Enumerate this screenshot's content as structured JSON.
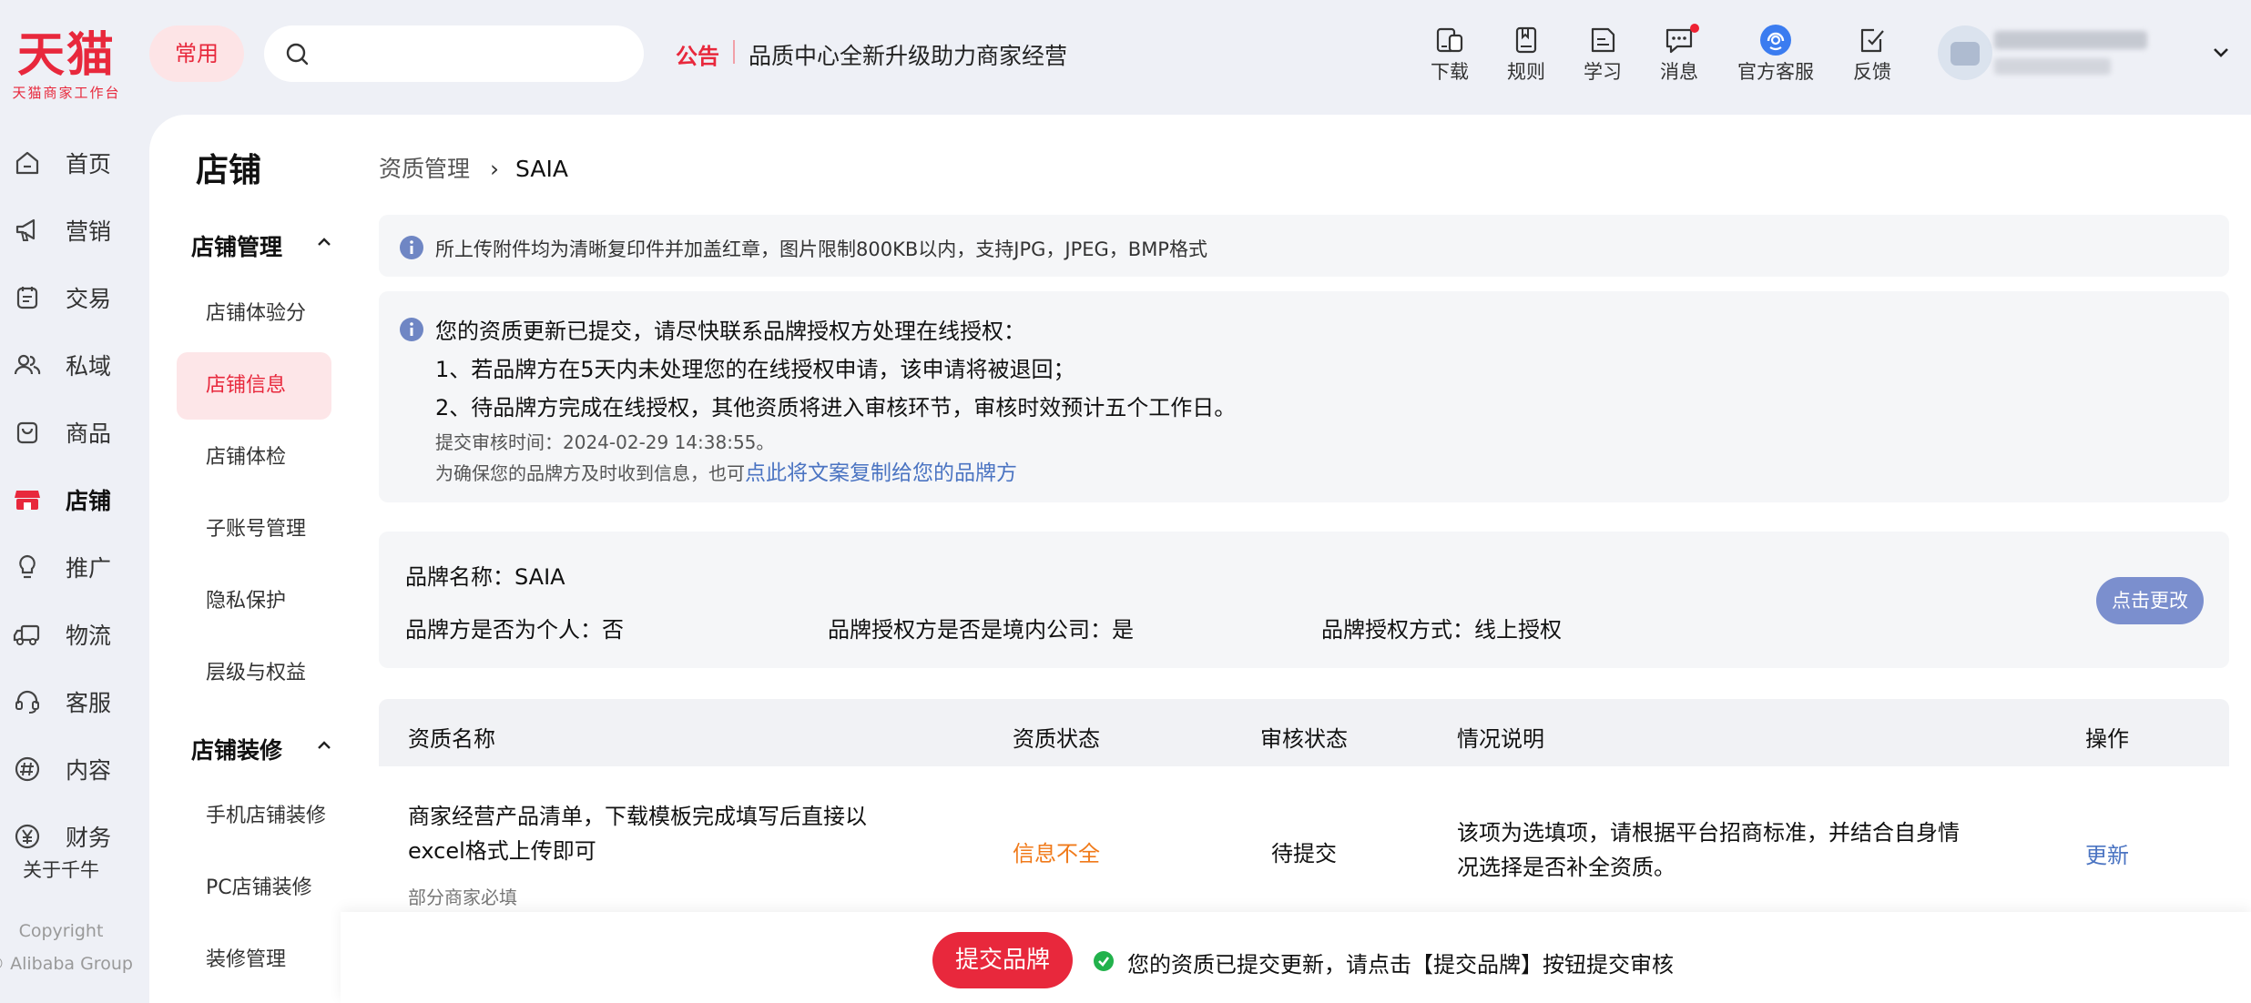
{
  "header": {
    "logo_big": "天猫",
    "logo_small": "天猫商家工作台",
    "common_label": "常用",
    "search_placeholder": "",
    "notice_label": "公告",
    "notice_text": "品质中心全新升级助力商家经营",
    "tools": [
      {
        "label": "下载",
        "icon": "download-icon"
      },
      {
        "label": "规则",
        "icon": "rules-icon"
      },
      {
        "label": "学习",
        "icon": "learn-icon"
      },
      {
        "label": "消息",
        "icon": "message-icon",
        "badge": true
      },
      {
        "label": "官方客服",
        "icon": "support-icon"
      },
      {
        "label": "反馈",
        "icon": "feedback-icon"
      }
    ]
  },
  "nav": {
    "items": [
      {
        "label": "首页",
        "icon": "home-icon"
      },
      {
        "label": "营销",
        "icon": "megaphone-icon"
      },
      {
        "label": "交易",
        "icon": "trade-icon"
      },
      {
        "label": "私域",
        "icon": "people-icon"
      },
      {
        "label": "商品",
        "icon": "bag-icon"
      },
      {
        "label": "店铺",
        "icon": "store-icon",
        "active": true
      },
      {
        "label": "推广",
        "icon": "bulb-icon"
      },
      {
        "label": "物流",
        "icon": "truck-icon"
      },
      {
        "label": "客服",
        "icon": "headset-icon"
      },
      {
        "label": "内容",
        "icon": "hash-icon"
      },
      {
        "label": "财务",
        "icon": "yen-icon"
      }
    ],
    "about": "关于千牛",
    "copyright": "Copyright",
    "company": "© Alibaba Group"
  },
  "sub_nav": {
    "title": "店铺",
    "groups": [
      {
        "label": "店铺管理",
        "items": [
          "店铺体验分",
          "店铺信息",
          "店铺体检",
          "子账号管理",
          "隐私保护",
          "层级与权益"
        ]
      },
      {
        "label": "店铺装修",
        "items": [
          "手机店铺装修",
          "PC店铺装修",
          "装修管理"
        ]
      }
    ],
    "active_item": "店铺信息"
  },
  "breadcrumb": {
    "parent": "资质管理",
    "separator": "›",
    "current": "SAIA"
  },
  "tip1": "所上传附件均为清晰复印件并加盖红章，图片限制800KB以内，支持JPG，JPEG，BMP格式",
  "tip2": {
    "heading": "您的资质更新已提交，请尽快联系品牌授权方处理在线授权：",
    "line1": "1、若品牌方在5天内未处理您的在线授权申请，该申请将被退回；",
    "line2": "2、待品牌方完成在线授权，其他资质将进入审核环节，审核时效预计五个工作日。",
    "submit_time": "提交审核时间：2024-02-29 14:38:55。",
    "hint_prefix": "为确保您的品牌方及时收到信息，也可",
    "hint_link": "点此将文案复制给您的品牌方"
  },
  "brand": {
    "name": "品牌名称：SAIA",
    "is_individual": "品牌方是否为个人：否",
    "is_domestic": "品牌授权方是否是境内公司：是",
    "auth_method": "品牌授权方式：线上授权",
    "change_button": "点击更改"
  },
  "table": {
    "headers": [
      "资质名称",
      "资质状态",
      "审核状态",
      "情况说明",
      "操作"
    ],
    "rows": [
      {
        "name": "商家经营产品清单，下载模板完成填写后直接以excel格式上传即可",
        "note": "部分商家必填",
        "status": "信息不全",
        "review": "待提交",
        "desc": "该项为选填项，请根据平台招商标准，并结合自身情况选择是否补全资质。",
        "action": "更新"
      }
    ]
  },
  "footer": {
    "submit_button": "提交品牌",
    "message": "您的资质已提交更新，请点击【提交品牌】按钮提交审核"
  },
  "colors": {
    "brand_red": "#e8283c",
    "link_blue": "#4b74c2",
    "warning_orange": "#f07a1a",
    "success_green": "#22b24c"
  }
}
